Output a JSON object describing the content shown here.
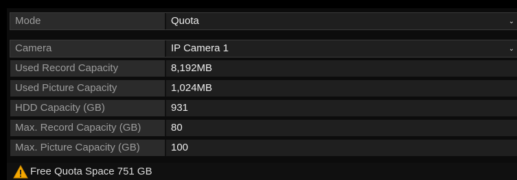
{
  "mode": {
    "label": "Mode",
    "value": "Quota"
  },
  "camera": {
    "label": "Camera",
    "value": "IP Camera 1"
  },
  "fields": [
    {
      "label": "Used Record Capacity",
      "value": "8,192MB"
    },
    {
      "label": "Used Picture Capacity",
      "value": "1,024MB"
    },
    {
      "label": "HDD Capacity (GB)",
      "value": "931"
    },
    {
      "label": "Max. Record Capacity (GB)",
      "value": "80"
    },
    {
      "label": "Max. Picture Capacity (GB)",
      "value": "100"
    }
  ],
  "footer": {
    "text": "Free Quota Space 751 GB",
    "icon": "warning-icon"
  },
  "colors": {
    "warning": "#f5a800",
    "label_bg": "#2b2b2b",
    "value_bg": "#1f1f1f"
  }
}
